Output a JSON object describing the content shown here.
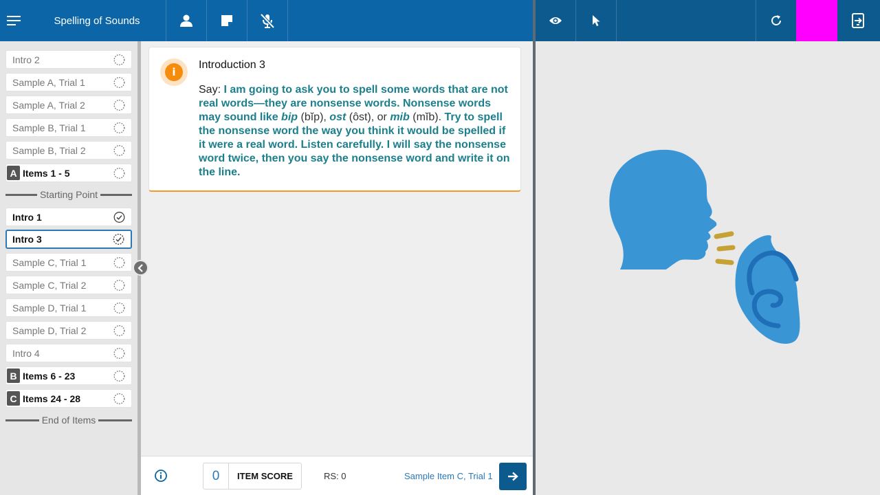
{
  "header": {
    "title": "Spelling of Sounds",
    "left_icons": [
      "menu-icon",
      "person-icon",
      "note-icon",
      "mic-off-icon"
    ],
    "right_icons": [
      "eye-icon",
      "pointer-icon",
      "refresh-icon",
      "exit-icon"
    ],
    "colors": {
      "left_bar": "#0b65a6",
      "right_bar": "#0d5a8f",
      "marker": "#ff00ff"
    }
  },
  "sidebar": {
    "items": [
      {
        "label": "Intro 2",
        "status": "pending"
      },
      {
        "label": "Sample A, Trial 1",
        "status": "pending"
      },
      {
        "label": "Sample A, Trial 2",
        "status": "pending"
      },
      {
        "label": "Sample B, Trial 1",
        "status": "pending"
      },
      {
        "label": "Sample B, Trial 2",
        "status": "pending"
      },
      {
        "letter": "A",
        "label": "Items 1 - 5",
        "status": "pending"
      },
      {
        "label": "Intro 1",
        "status": "complete"
      },
      {
        "label": "Intro 3",
        "status": "in-progress"
      },
      {
        "label": "Sample C, Trial 1",
        "status": "pending"
      },
      {
        "label": "Sample C, Trial 2",
        "status": "pending"
      },
      {
        "label": "Sample D, Trial 1",
        "status": "pending"
      },
      {
        "label": "Sample D, Trial 2",
        "status": "pending"
      },
      {
        "label": "Intro 4",
        "status": "pending"
      },
      {
        "letter": "B",
        "label": "Items 6 - 23",
        "status": "pending"
      },
      {
        "letter": "C",
        "label": "Items 24 - 28",
        "status": "pending"
      }
    ],
    "starting_point_label": "Starting Point",
    "end_label": "End of Items"
  },
  "card": {
    "title": "Introduction 3",
    "say_label": "Say:",
    "part1": "I am going to ask you to spell some words that are not real words—they are nonsense words. Nonsense words may sound like",
    "w1": "bip",
    "p1": "(bĭp),",
    "w2": "ost",
    "p2": "(ôst), or",
    "w3": "mib",
    "p3": "(mĭb).",
    "part2": "Try to spell the nonsense word the way you think it would be spelled if it were a real word. Listen carefully. I will say the nonsense word twice, then you say the nonsense word and write it on the line.",
    "accent_color": "#f39a28"
  },
  "footer": {
    "item_score_value": "0",
    "item_score_label": "ITEM SCORE",
    "rs_label": "RS: 0",
    "next_item_label": "Sample Item C, Trial 1"
  }
}
